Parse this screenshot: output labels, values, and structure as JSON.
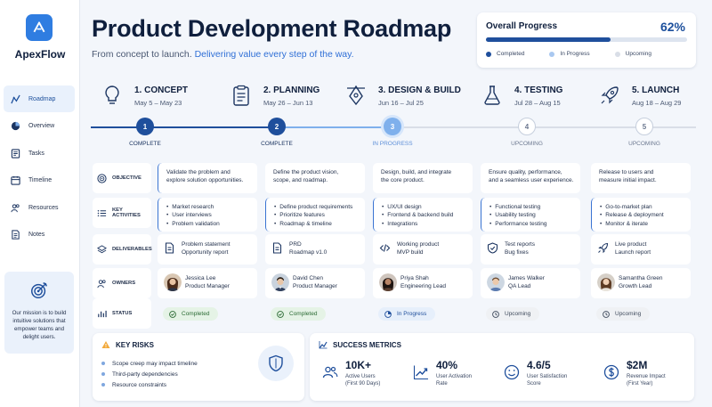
{
  "app": {
    "name": "ApexFlow"
  },
  "sidebar": {
    "items": [
      {
        "label": "Roadmap",
        "icon": "roadmap-icon",
        "active": true
      },
      {
        "label": "Overview",
        "icon": "pie-chart-icon"
      },
      {
        "label": "Tasks",
        "icon": "tasks-icon"
      },
      {
        "label": "Timeline",
        "icon": "calendar-icon"
      },
      {
        "label": "Resources",
        "icon": "people-icon"
      },
      {
        "label": "Notes",
        "icon": "notes-icon"
      }
    ],
    "mission": "Our mission is to build intuitive solutions that empower teams and delight users."
  },
  "header": {
    "title": "Product Development Roadmap",
    "subtitle_plain": "From concept to launch. ",
    "subtitle_highlight": "Delivering value every step of the way."
  },
  "overall_progress": {
    "title": "Overall Progress",
    "percent_label": "62%",
    "value": 0.62,
    "legend": [
      "Completed",
      "In Progress",
      "Upcoming"
    ]
  },
  "phases": [
    {
      "name": "1. CONCEPT",
      "dates": "May 5 – May 23",
      "number": "1",
      "status": "COMPLETE",
      "icon": "lightbulb-icon"
    },
    {
      "name": "2. PLANNING",
      "dates": "May 26 – Jun 13",
      "number": "2",
      "status": "COMPLETE",
      "icon": "clipboard-icon"
    },
    {
      "name": "3. DESIGN & BUILD",
      "dates": "Jun 16 – Jul 25",
      "number": "3",
      "status": "IN PROGRESS",
      "icon": "design-pen-icon"
    },
    {
      "name": "4. TESTING",
      "dates": "Jul 28 – Aug 15",
      "number": "4",
      "status": "UPCOMING",
      "icon": "flask-icon"
    },
    {
      "name": "5. LAUNCH",
      "dates": "Aug 18 – Aug 29",
      "number": "5",
      "status": "UPCOMING",
      "icon": "rocket-icon"
    }
  ],
  "rows": {
    "labels": {
      "objective": "OBJECTIVE",
      "activities": "KEY ACTIVITIES",
      "deliverables": "DELIVERABLES",
      "owners": "OWNERS",
      "status": "STATUS"
    },
    "objective": [
      [
        "Validate the problem and",
        "explore solution opportunities."
      ],
      [
        "Define the product vision,",
        "scope, and roadmap."
      ],
      [
        "Design, build, and integrate",
        "the core product."
      ],
      [
        "Ensure quality, performance,",
        "and a seamless user experience."
      ],
      [
        "Release to users and",
        "measure initial impact."
      ]
    ],
    "activities": [
      [
        "Market research",
        "User interviews",
        "Problem validation"
      ],
      [
        "Define product requirements",
        "Prioritize features",
        "Roadmap & timeline"
      ],
      [
        "UX/UI design",
        "Frontend & backend build",
        "Integrations"
      ],
      [
        "Functional testing",
        "Usability testing",
        "Performance testing"
      ],
      [
        "Go-to-market plan",
        "Release & deployment",
        "Monitor & iterate"
      ]
    ],
    "deliverables": [
      {
        "lines": [
          "Problem statement",
          "Opportunity report"
        ],
        "icon": "document-icon"
      },
      {
        "lines": [
          "PRD",
          "Roadmap v1.0"
        ],
        "icon": "document-icon"
      },
      {
        "lines": [
          "Working product",
          "MVP build"
        ],
        "icon": "code-icon"
      },
      {
        "lines": [
          "Test reports",
          "Bug fixes"
        ],
        "icon": "shield-check-icon"
      },
      {
        "lines": [
          "Live product",
          "Launch report"
        ],
        "icon": "rocket-icon"
      }
    ],
    "owners": [
      {
        "name": "Jessica Lee",
        "role": "Product Manager"
      },
      {
        "name": "David Chen",
        "role": "Product Manager"
      },
      {
        "name": "Priya Shah",
        "role": "Engineering Lead"
      },
      {
        "name": "James Walker",
        "role": "QA Lead"
      },
      {
        "name": "Samantha Green",
        "role": "Growth Lead"
      }
    ],
    "status": [
      {
        "label": "Completed",
        "kind": "ok"
      },
      {
        "label": "Completed",
        "kind": "ok"
      },
      {
        "label": "In Progress",
        "kind": "pr"
      },
      {
        "label": "Upcoming",
        "kind": "up"
      },
      {
        "label": "Upcoming",
        "kind": "up"
      }
    ]
  },
  "risks": {
    "title": "KEY RISKS",
    "items": [
      "Scope creep may impact timeline",
      "Third-party dependencies",
      "Resource constraints"
    ]
  },
  "metrics": {
    "title": "SUCCESS METRICS",
    "items": [
      {
        "value": "10K+",
        "label1": "Active Users",
        "label2": "(First 90 Days)",
        "icon": "users-icon"
      },
      {
        "value": "40%",
        "label1": "User Activation",
        "label2": "Rate",
        "icon": "trend-up-icon"
      },
      {
        "value": "4.6/5",
        "label1": "User Satisfaction",
        "label2": "Score",
        "icon": "smile-icon"
      },
      {
        "value": "$2M",
        "label1": "Revenue Impact",
        "label2": "(First Year)",
        "icon": "dollar-icon"
      }
    ]
  },
  "colors": {
    "primary": "#1f4f9c",
    "accent": "#2f7de1",
    "in_progress": "#7fb0ec",
    "upcoming": "#c6cfdd",
    "success": "#2b6b34"
  }
}
